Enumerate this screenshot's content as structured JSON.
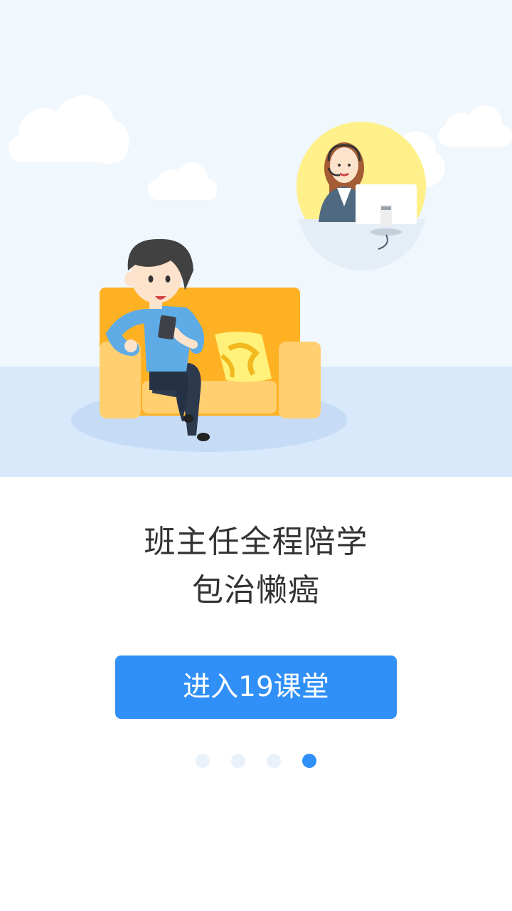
{
  "headline": {
    "line1": "班主任全程陪学",
    "line2": "包治懒癌"
  },
  "enter_button": {
    "label": "进入19课堂"
  },
  "pager": {
    "count": 4,
    "active_index": 3
  },
  "colors": {
    "accent": "#3190f7",
    "sky": "#f0f7fd",
    "floor": "#d8e9fb",
    "sofa": "#ffb124",
    "dot_inactive": "#e9f1fa"
  }
}
